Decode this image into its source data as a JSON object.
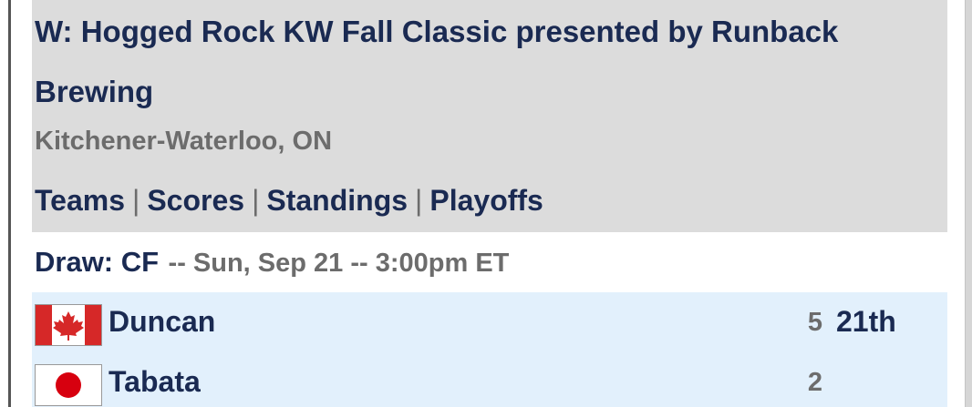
{
  "event": {
    "title": "W: Hogged Rock KW Fall Classic presented by Runback Brewing",
    "location": "Kitchener-Waterloo, ON"
  },
  "nav": {
    "teams": "Teams",
    "scores": "Scores",
    "standings": "Standings",
    "playoffs": "Playoffs",
    "separator": "|"
  },
  "draw": {
    "label": "Draw: CF",
    "info": "-- Sun, Sep 21 -- 3:00pm ET"
  },
  "game": {
    "rows": [
      {
        "team": "Duncan",
        "flag": "canada-flag-icon",
        "score": "5",
        "end": "21th"
      },
      {
        "team": "Tabata",
        "flag": "japan-flag-icon",
        "score": "2",
        "end": ""
      }
    ]
  },
  "colors": {
    "header_bg": "#dcdcdc",
    "text_navy": "#1a2a52",
    "text_gray": "#6c6c6c",
    "game_bg": "#e2f0fc"
  }
}
